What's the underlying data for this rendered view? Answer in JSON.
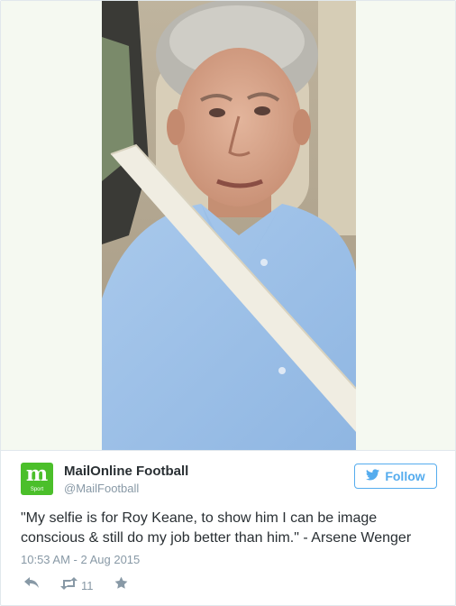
{
  "tweet": {
    "author": {
      "name": "MailOnline Football",
      "handle": "@MailFootball",
      "avatar_logo_text": "m",
      "avatar_logo_subtext": "Sport"
    },
    "follow_label": "Follow",
    "text": "\"My selfie is for Roy Keane, to show him I can be image conscious & still do my job better than him.\" - Arsene Wenger",
    "timestamp": "10:53 AM - 2 Aug 2015",
    "retweet_count": "11"
  },
  "icons": {
    "follow": "twitter-bird-icon",
    "reply": "reply-icon",
    "retweet": "retweet-icon",
    "favorite": "star-icon"
  },
  "colors": {
    "accent": "#55acee",
    "text": "#292f33",
    "muted": "#8899a6",
    "avatar_green": "#4bbf2a",
    "border": "#e1e8ed"
  }
}
